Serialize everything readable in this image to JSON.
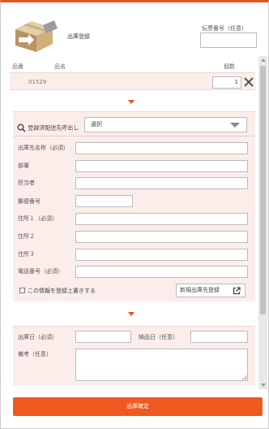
{
  "header": {
    "title": "出庫登録",
    "slip_label": "伝票番号（任意）",
    "slip_value": ""
  },
  "columns": {
    "product_code": "品番",
    "product_name": "品名",
    "quantity": "個数"
  },
  "item": {
    "code": "01529",
    "quantity": "1"
  },
  "address_search": {
    "label": "登録済配送先呼出し",
    "selected": "選択"
  },
  "address_form": {
    "name_label": "出庫先名称（必須）",
    "department_label": "部署",
    "contact_label": "担当者",
    "postal_label": "郵便番号",
    "address1_label": "住所１（必須）",
    "address2_label": "住所２",
    "address3_label": "住所３",
    "phone_label": "電話番号（必須）",
    "overwrite_label": "この情報を登録上書きする",
    "new_register_label": "新規出庫先登録"
  },
  "schedule": {
    "ship_date_label": "出庫日（必須）",
    "delivery_date_label": "納品日（任意）",
    "note_label": "備考（任意）"
  },
  "actions": {
    "confirm_label": "出庫確定"
  },
  "colors": {
    "accent": "#ef5a21",
    "panel_bg": "#fbeeea"
  }
}
